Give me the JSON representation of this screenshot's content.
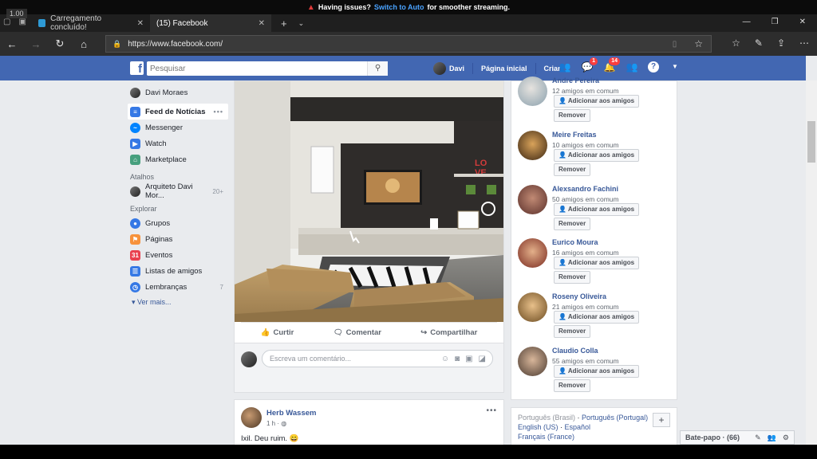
{
  "stream_banner": {
    "version": "1.00",
    "message": "Having issues?",
    "link": "Switch to Auto",
    "suffix": "for smoother streaming."
  },
  "browser": {
    "tabs": [
      {
        "title": "Carregamento concluído!",
        "active": false
      },
      {
        "title": "(15) Facebook",
        "active": true
      }
    ],
    "new_tab": "+",
    "url": "https://www.facebook.com/"
  },
  "fb_header": {
    "logo": "f",
    "search_placeholder": "Pesquisar",
    "user_name": "Davi",
    "home": "Página inicial",
    "create": "Criar",
    "messages_badge": "1",
    "notifications_badge": "14",
    "accent": "#4267b2"
  },
  "left_nav": {
    "profile": "Davi Moraes",
    "items": [
      {
        "label": "Feed de Notícias",
        "icon": "news-feed-icon",
        "color": "#3578e5"
      },
      {
        "label": "Messenger",
        "icon": "messenger-icon",
        "color": "#0084ff"
      },
      {
        "label": "Watch",
        "icon": "watch-icon",
        "color": "#3578e5"
      },
      {
        "label": "Marketplace",
        "icon": "marketplace-icon",
        "color": "#47a07e"
      }
    ],
    "shortcuts_title": "Atalhos",
    "shortcuts": [
      {
        "label": "Arquiteto Davi Mor...",
        "count": "20+"
      }
    ],
    "explore_title": "Explorar",
    "explore": [
      {
        "label": "Grupos",
        "icon": "groups-icon",
        "color": "#3578e5",
        "count": ""
      },
      {
        "label": "Páginas",
        "icon": "pages-icon",
        "color": "#f7923b",
        "count": ""
      },
      {
        "label": "Eventos",
        "icon": "events-icon",
        "color": "#e9414f",
        "count": ""
      },
      {
        "label": "Listas de amigos",
        "icon": "friend-lists-icon",
        "color": "#3578e5",
        "count": ""
      },
      {
        "label": "Lembranças",
        "icon": "memories-icon",
        "color": "#3578e5",
        "count": "7"
      }
    ],
    "see_more": "Ver mais..."
  },
  "post": {
    "actions": {
      "like": "Curtir",
      "comment": "Comentar",
      "share": "Compartilhar"
    },
    "comment_placeholder": "Escreva um comentário..."
  },
  "post2": {
    "author": "Herb Wassem",
    "time": "1 h",
    "text": "Ixil. Deu ruim. 😄"
  },
  "people": {
    "mutual_suffix": "amigos em comum",
    "add_label": "Adicionar aos amigos",
    "remove_label": "Remover",
    "list": [
      {
        "name": "Andre Pereira",
        "mutual": "12 amigos em comum"
      },
      {
        "name": "Meire Freitas",
        "mutual": "10 amigos em comum"
      },
      {
        "name": "Alexsandro Fachini",
        "mutual": "50 amigos em comum"
      },
      {
        "name": "Eurico Moura",
        "mutual": "16 amigos em comum"
      },
      {
        "name": "Roseny Oliveira",
        "mutual": "21 amigos em comum"
      },
      {
        "name": "Claudio Colla",
        "mutual": "55 amigos em comum"
      }
    ]
  },
  "languages": {
    "current": "Português (Brasil)",
    "others": [
      "Português (Portugal)",
      "English (US)",
      "Español",
      "Français (France)"
    ]
  },
  "chat": {
    "label": "Bate-papo · (66)"
  }
}
